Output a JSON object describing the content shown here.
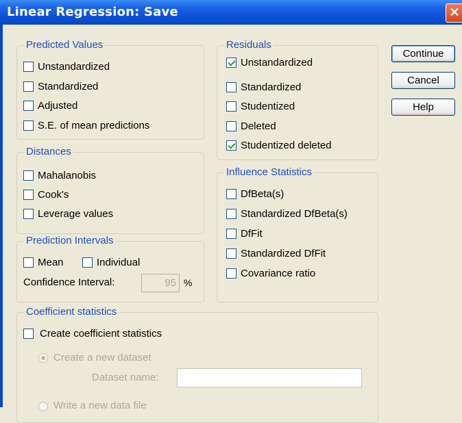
{
  "window": {
    "title": "Linear Regression: Save",
    "close_glyph": "✕"
  },
  "predicted_values": {
    "legend": "Predicted Values",
    "items": [
      {
        "label": "Unstandardized",
        "checked": false
      },
      {
        "label": "Standardized",
        "checked": false
      },
      {
        "label": "Adjusted",
        "checked": false
      },
      {
        "label": "S.E. of mean predictions",
        "checked": false
      }
    ]
  },
  "distances": {
    "legend": "Distances",
    "items": [
      {
        "label": "Mahalanobis",
        "checked": false
      },
      {
        "label": "Cook's",
        "checked": false
      },
      {
        "label": "Leverage values",
        "checked": false
      }
    ]
  },
  "prediction_intervals": {
    "legend": "Prediction Intervals",
    "mean": {
      "label": "Mean",
      "checked": false
    },
    "individual": {
      "label": "Individual",
      "checked": false
    },
    "confidence_label": "Confidence Interval:",
    "confidence_value": "95",
    "percent": "%"
  },
  "residuals": {
    "legend": "Residuals",
    "items": [
      {
        "label": "Unstandardized",
        "checked": true
      },
      {
        "label": "Standardized",
        "checked": false
      },
      {
        "label": "Studentized",
        "checked": false
      },
      {
        "label": "Deleted",
        "checked": false
      },
      {
        "label": "Studentized deleted",
        "checked": true
      }
    ]
  },
  "influence": {
    "legend": "Influence Statistics",
    "items": [
      {
        "label": "DfBeta(s)",
        "checked": false
      },
      {
        "label": "Standardized DfBeta(s)",
        "checked": false
      },
      {
        "label": "DfFit",
        "checked": false
      },
      {
        "label": "Standardized DfFit",
        "checked": false
      },
      {
        "label": "Covariance ratio",
        "checked": false
      }
    ]
  },
  "coefficient": {
    "legend": "Coefficient statistics",
    "create": {
      "label": "Create coefficient statistics",
      "checked": false
    },
    "new_dataset": {
      "label": "Create a new dataset",
      "selected": true
    },
    "dataset_name_label": "Dataset name:",
    "dataset_name_value": "",
    "write_file": {
      "label": "Write a new data file",
      "selected": false
    }
  },
  "buttons": {
    "continue": "Continue",
    "cancel": "Cancel",
    "help": "Help"
  },
  "colors": {
    "title_bar": "#0b48c0",
    "legend_text": "#1f4fbf",
    "check_mark": "#21a121",
    "close_button": "#d6451f"
  }
}
